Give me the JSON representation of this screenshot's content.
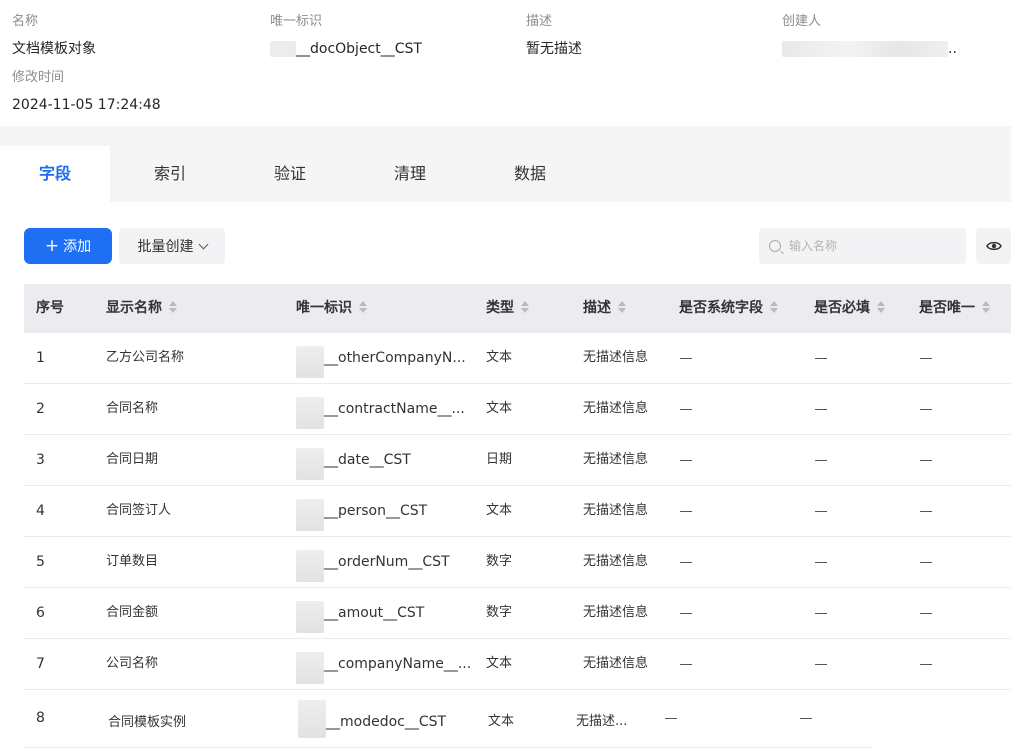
{
  "meta": {
    "name_label": "名称",
    "name_value": "文档模板对象",
    "id_label": "唯一标识",
    "id_value": "__docObject__CST",
    "desc_label": "描述",
    "desc_value": "暂无描述",
    "creator_label": "创建人",
    "creator_suffix": "..",
    "modified_label": "修改时间",
    "modified_value": "2024-11-05 17:24:48"
  },
  "tabs": [
    {
      "label": "字段",
      "active": true
    },
    {
      "label": "索引",
      "active": false
    },
    {
      "label": "验证",
      "active": false
    },
    {
      "label": "清理",
      "active": false
    },
    {
      "label": "数据",
      "active": false
    }
  ],
  "toolbar": {
    "add_label": "添加",
    "batch_label": "批量创建",
    "search_placeholder": "输入名称"
  },
  "table": {
    "columns": [
      "序号",
      "显示名称",
      "唯一标识",
      "类型",
      "描述",
      "是否系统字段",
      "是否必填",
      "是否唯一"
    ],
    "rows": [
      {
        "no": "1",
        "name": "乙方公司名称",
        "id": "__otherCompanyN...",
        "type": "文本",
        "desc": "无描述信息"
      },
      {
        "no": "2",
        "name": "合同名称",
        "id": "__contractName__...",
        "type": "文本",
        "desc": "无描述信息"
      },
      {
        "no": "3",
        "name": "合同日期",
        "id": "__date__CST",
        "type": "日期",
        "desc": "无描述信息"
      },
      {
        "no": "4",
        "name": "合同签订人",
        "id": "__person__CST",
        "type": "文本",
        "desc": "无描述信息"
      },
      {
        "no": "5",
        "name": "订单数目",
        "id": "__orderNum__CST",
        "type": "数字",
        "desc": "无描述信息"
      },
      {
        "no": "6",
        "name": "合同金额",
        "id": "__amout__CST",
        "type": "数字",
        "desc": "无描述信息"
      },
      {
        "no": "7",
        "name": "公司名称",
        "id": "__companyName__...",
        "type": "文本",
        "desc": "无描述信息"
      },
      {
        "no": "8",
        "name": "合同模板实例",
        "id": "__modedoc__CST",
        "type": "文本",
        "desc": "无描述..."
      }
    ]
  },
  "colors": {
    "primary": "#1f6ff2",
    "header_bg": "#ececf0",
    "tabbar_bg": "#f5f5f6"
  }
}
